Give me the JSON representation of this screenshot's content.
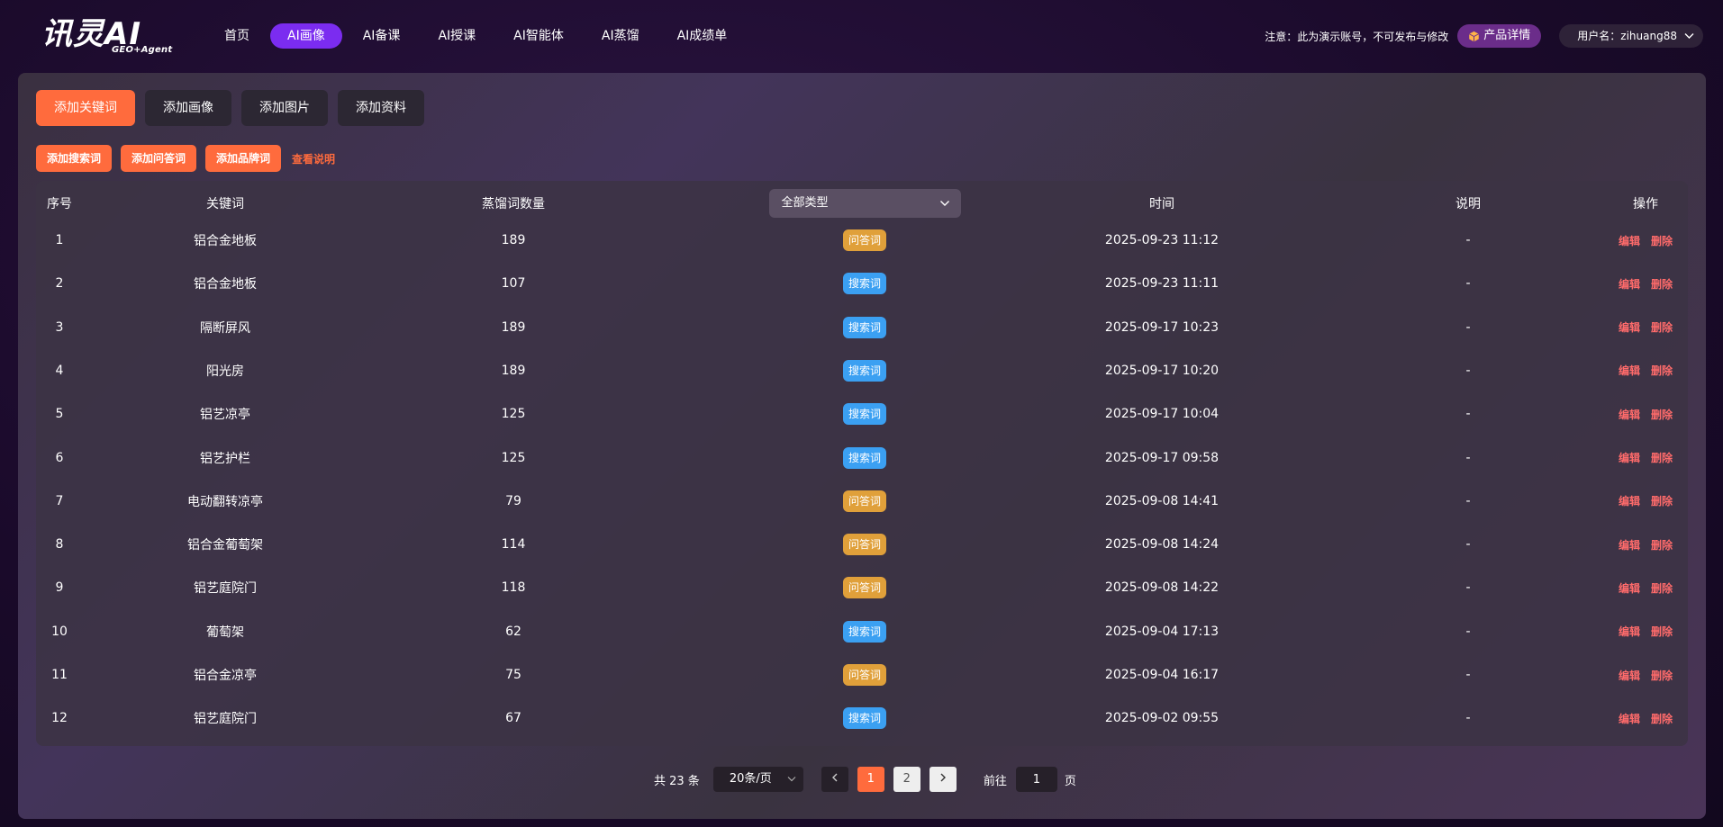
{
  "header": {
    "logo_main": "讯灵AI",
    "logo_sub": "GEO+Agent",
    "nav": [
      "首页",
      "AI画像",
      "AI备课",
      "AI授课",
      "AI智能体",
      "AI蒸馏",
      "AI成绩单"
    ],
    "active_nav": 1,
    "notice": "注意：此为演示账号，不可发布与修改",
    "product_btn": "产品详情",
    "user_label": "用户名：zihuang88"
  },
  "tabs": [
    "添加关键词",
    "添加画像",
    "添加图片",
    "添加资料"
  ],
  "active_tab": 0,
  "sub_buttons": [
    "添加搜索词",
    "添加问答词",
    "添加品牌词"
  ],
  "help_link": "查看说明",
  "table": {
    "headers": {
      "index": "序号",
      "keyword": "关键词",
      "count": "蒸馏词数量",
      "type_filter": "全部类型",
      "time": "时间",
      "desc": "说明",
      "ops": "操作"
    },
    "op_edit": "编辑",
    "op_delete": "删除",
    "rows": [
      {
        "idx": "1",
        "keyword": "铝合金地板",
        "count": "189",
        "type": "问答词",
        "kind": "qa",
        "time": "2025-09-23 11:12",
        "desc": "-"
      },
      {
        "idx": "2",
        "keyword": "铝合金地板",
        "count": "107",
        "type": "搜索词",
        "kind": "search",
        "time": "2025-09-23 11:11",
        "desc": "-"
      },
      {
        "idx": "3",
        "keyword": "隔断屏风",
        "count": "189",
        "type": "搜索词",
        "kind": "search",
        "time": "2025-09-17 10:23",
        "desc": "-"
      },
      {
        "idx": "4",
        "keyword": "阳光房",
        "count": "189",
        "type": "搜索词",
        "kind": "search",
        "time": "2025-09-17 10:20",
        "desc": "-"
      },
      {
        "idx": "5",
        "keyword": "铝艺凉亭",
        "count": "125",
        "type": "搜索词",
        "kind": "search",
        "time": "2025-09-17 10:04",
        "desc": "-"
      },
      {
        "idx": "6",
        "keyword": "铝艺护栏",
        "count": "125",
        "type": "搜索词",
        "kind": "search",
        "time": "2025-09-17 09:58",
        "desc": "-"
      },
      {
        "idx": "7",
        "keyword": "电动翻转凉亭",
        "count": "79",
        "type": "问答词",
        "kind": "qa",
        "time": "2025-09-08 14:41",
        "desc": "-"
      },
      {
        "idx": "8",
        "keyword": "铝合金葡萄架",
        "count": "114",
        "type": "问答词",
        "kind": "qa",
        "time": "2025-09-08 14:24",
        "desc": "-"
      },
      {
        "idx": "9",
        "keyword": "铝艺庭院门",
        "count": "118",
        "type": "问答词",
        "kind": "qa",
        "time": "2025-09-08 14:22",
        "desc": "-"
      },
      {
        "idx": "10",
        "keyword": "葡萄架",
        "count": "62",
        "type": "搜索词",
        "kind": "search",
        "time": "2025-09-04 17:13",
        "desc": "-"
      },
      {
        "idx": "11",
        "keyword": "铝合金凉亭",
        "count": "75",
        "type": "问答词",
        "kind": "qa",
        "time": "2025-09-04 16:17",
        "desc": "-"
      },
      {
        "idx": "12",
        "keyword": "铝艺庭院门",
        "count": "67",
        "type": "搜索词",
        "kind": "search",
        "time": "2025-09-02 09:55",
        "desc": "-"
      }
    ]
  },
  "pagination": {
    "total": "共 23 条",
    "page_size": "20条/页",
    "pages": [
      "1",
      "2"
    ],
    "current": 0,
    "goto_label": "前往",
    "goto_value": "1",
    "goto_suffix": "页"
  },
  "colors": {
    "accent": "#ff6b3d",
    "nav_active": "#7b2cf0",
    "badge_qa": "#e0a03a",
    "badge_search": "#3ba0f2"
  }
}
